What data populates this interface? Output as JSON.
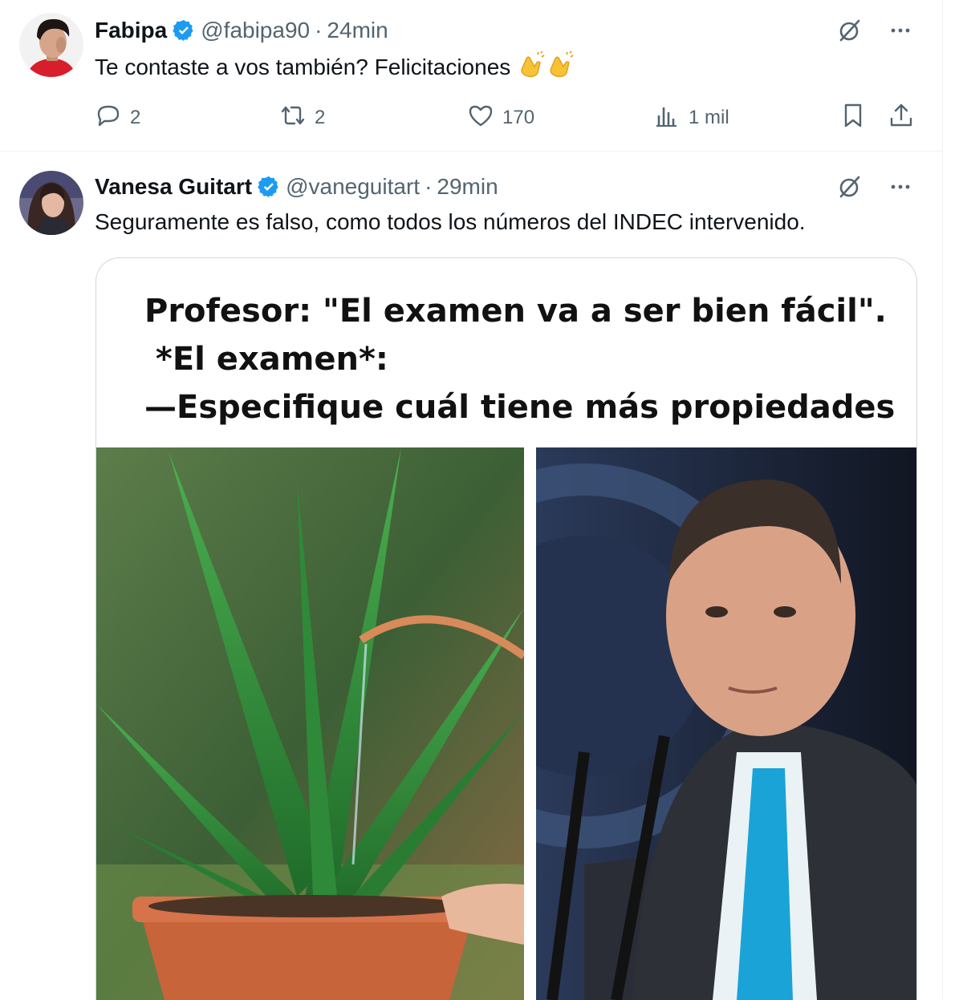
{
  "tweets": [
    {
      "name": "Fabipa",
      "handle": "@fabipa90",
      "dot": "·",
      "time": "24min",
      "text": "Te contaste a vos también? Felicitaciones",
      "actions": {
        "replies": "2",
        "reposts": "2",
        "likes": "170",
        "views": "1 mil"
      }
    },
    {
      "name": "Vanesa Guitart",
      "handle": "@vaneguitart",
      "dot": "·",
      "time": "29min",
      "text": "Seguramente es falso, como todos los números del INDEC intervenido.",
      "media": {
        "meme_lines": [
          "Profesor: \"El examen va a ser bien fácil\".",
          " *El examen*:",
          "—Especifique cuál tiene más propiedades"
        ]
      }
    }
  ],
  "icons": {
    "verified": "verified-badge-icon",
    "grok": "grok-icon",
    "more": "more-icon",
    "reply": "reply-icon",
    "repost": "repost-icon",
    "like": "like-icon",
    "views": "views-icon",
    "bookmark": "bookmark-icon",
    "share": "share-icon",
    "clap": "clapping-hands-icon"
  },
  "colors": {
    "text": "#0f1419",
    "secondary": "#536471",
    "verified": "#1d9bf0",
    "divider": "#eff3f4"
  }
}
